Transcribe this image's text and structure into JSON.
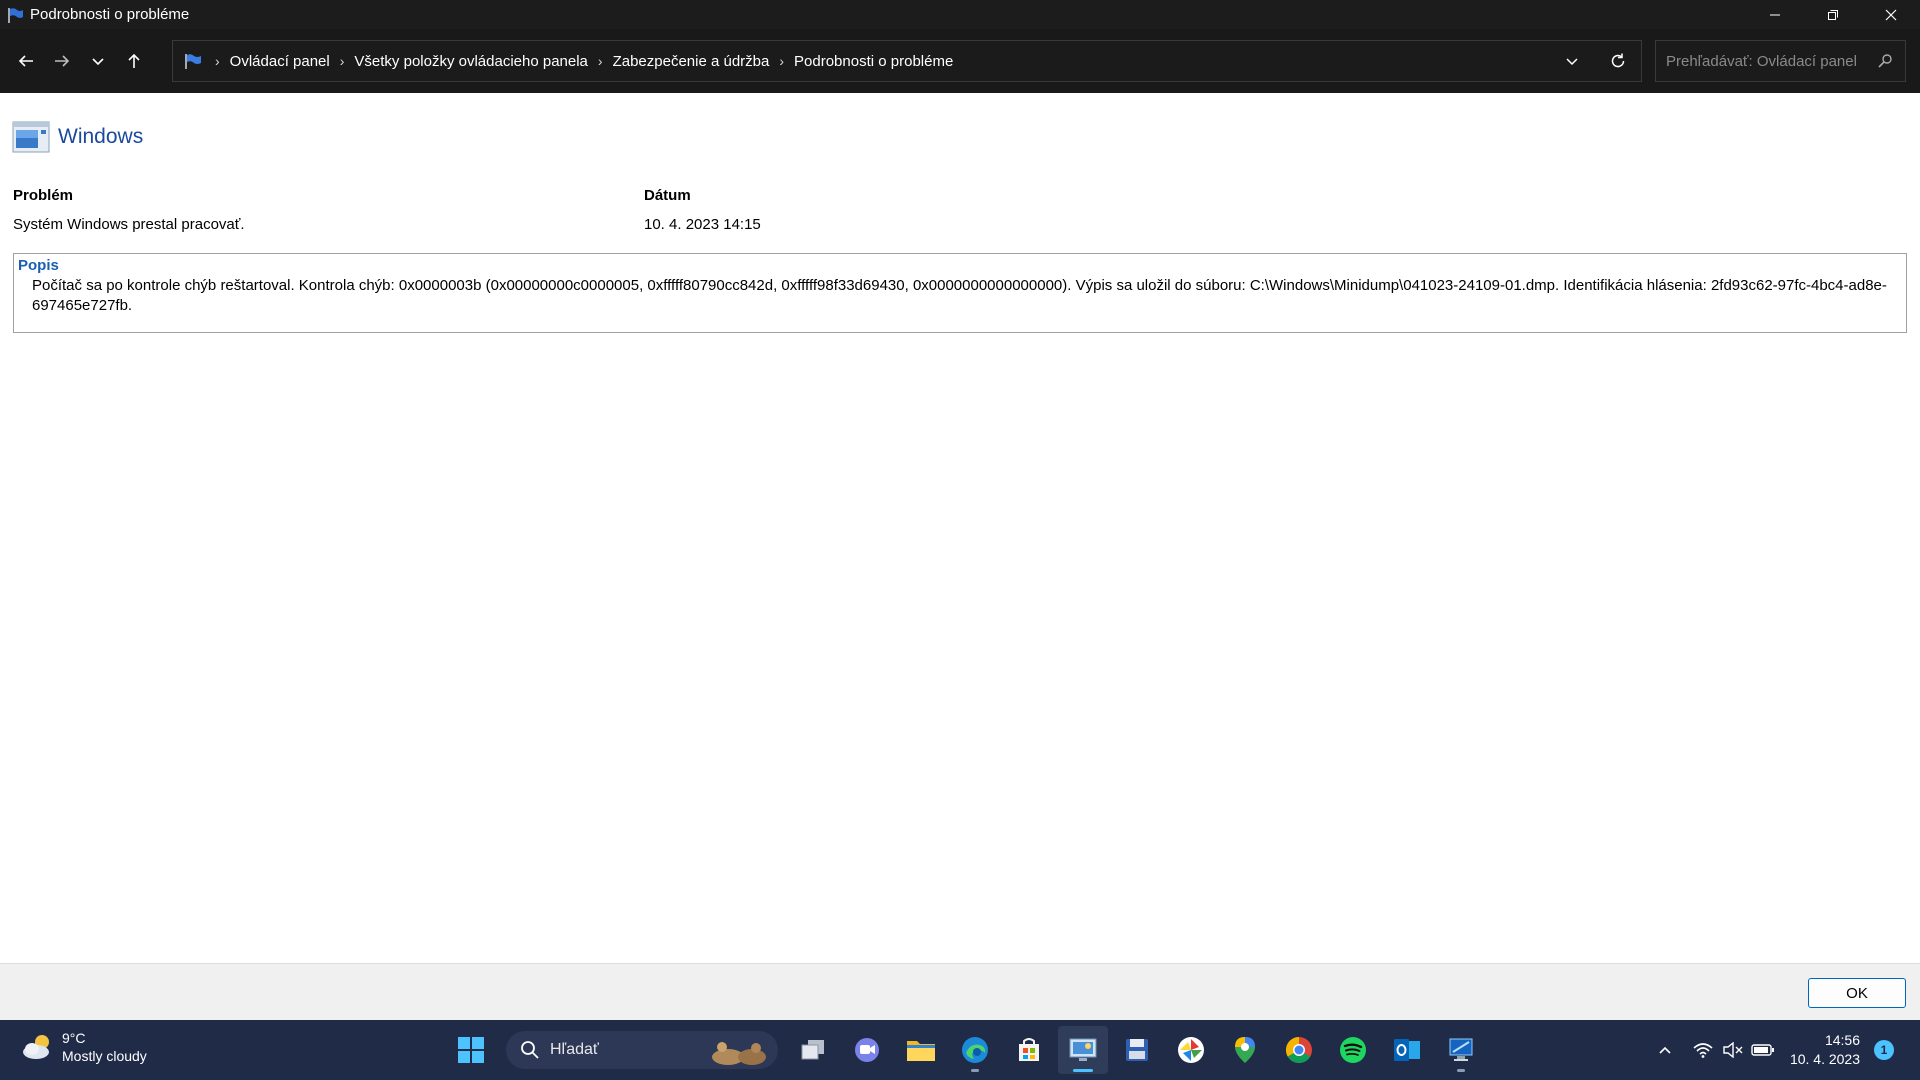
{
  "window": {
    "title": "Podrobnosti o probléme"
  },
  "breadcrumb": [
    "Ovládací panel",
    "Všetky položky ovládacieho panela",
    "Zabezpečenie a údržba",
    "Podrobnosti o probléme"
  ],
  "search": {
    "placeholder": "Prehľadávať: Ovládací panel"
  },
  "content": {
    "program": "Windows",
    "problem_label": "Problém",
    "problem_value": "Systém Windows prestal pracovať.",
    "date_label": "Dátum",
    "date_value": "10. 4. 2023 14:15",
    "description_label": "Popis",
    "description_text": "Počítač sa po kontrole chýb reštartoval. Kontrola chýb: 0x0000003b (0x00000000c0000005, 0xfffff80790cc842d, 0xfffff98f33d69430, 0x0000000000000000). Výpis sa uložil do súboru: C:\\Windows\\Minidump\\041023-24109-01.dmp. Identifikácia hlásenia: 2fd93c62-97fc-4bc4-ad8e-697465e727fb."
  },
  "footer": {
    "ok_label": "OK"
  },
  "taskbar": {
    "weather_temp": "9°C",
    "weather_desc": "Mostly cloudy",
    "search_placeholder": "Hľadať",
    "apps": [
      "task-view-icon",
      "teams-chat-icon",
      "file-explorer-icon",
      "edge-icon",
      "microsoft-store-icon",
      "control-panel-icon",
      "floppy-save-icon",
      "colorful-app-icon",
      "maps-pin-icon",
      "chrome-icon",
      "spotify-icon",
      "outlook-icon",
      "remote-desktop-icon"
    ],
    "time": "14:56",
    "date": "10. 4. 2023",
    "notification_count": "1"
  },
  "colors": {
    "accent": "#0067c0",
    "link_blue": "#1a5fb4",
    "taskbar_bg": "#1f2b47",
    "titlebar_bg": "#1c1c1c"
  }
}
